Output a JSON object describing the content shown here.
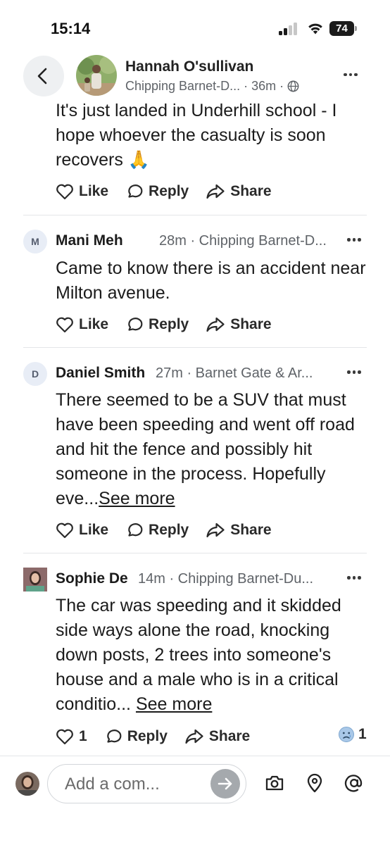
{
  "status_bar": {
    "time": "15:14",
    "battery": "74"
  },
  "post_header": {
    "author": "Hannah O'sullivan",
    "location": "Chipping Barnet-D...",
    "time": "· 36m ·",
    "icons": {
      "back": "chevron-left-icon",
      "globe": "globe-icon",
      "more": "more-icon"
    }
  },
  "comments": [
    {
      "avatar_letter": "",
      "name": "",
      "meta": "",
      "text": "It's just landed in Underhill school - I hope whoever the casualty is soon recovers 🙏",
      "see_more": "",
      "actions": {
        "like": "Like",
        "reply": "Reply",
        "share": "Share"
      }
    },
    {
      "avatar_letter": "M",
      "name": "Mani Meh",
      "meta": "28m · Chipping Barnet-D...",
      "text": "Came to know there is an accident near Milton avenue.",
      "see_more": "",
      "actions": {
        "like": "Like",
        "reply": "Reply",
        "share": "Share"
      }
    },
    {
      "avatar_letter": "D",
      "name": "Daniel Smith",
      "meta": "27m · Barnet Gate & Ar...",
      "text": "There seemed to be a SUV that must have been speeding and went off road and hit the fence and possibly hit someone in the process. Hopefully eve...",
      "see_more": "See more",
      "actions": {
        "like": "Like",
        "reply": "Reply",
        "share": "Share"
      }
    },
    {
      "avatar_letter": "",
      "name": "Sophie De",
      "meta": "14m · Chipping Barnet-Du...",
      "text": "The car was speeding and it skidded side ways alone the road, knocking down posts, 2 trees into someone's house and a male who is in a critical conditio...",
      "see_more": "See more",
      "actions": {
        "like": "1",
        "reply": "Reply",
        "share": "Share"
      },
      "reaction_count": "1",
      "reaction_icon": "sad-face-icon"
    }
  ],
  "composer": {
    "placeholder": "Add a com...",
    "icons": [
      "camera-icon",
      "location-pin-icon",
      "at-sign-icon"
    ]
  },
  "colors": {
    "divider": "#e4e6e8",
    "meta_text": "#5f6368",
    "send_button": "#a5a9ad",
    "back_button_bg": "#eef0f2"
  }
}
